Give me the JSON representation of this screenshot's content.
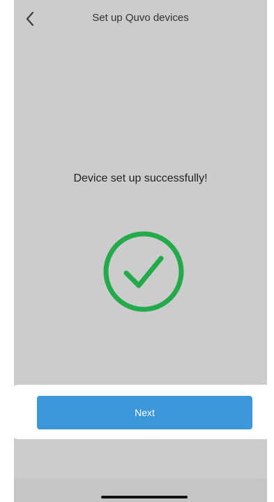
{
  "header": {
    "title": "Set up Quvo devices",
    "back_icon": "chevron-left-icon"
  },
  "main": {
    "message": "Device set up successfully!",
    "status_icon": "check-circle-icon"
  },
  "footer": {
    "next_label": "Next"
  },
  "colors": {
    "screen_background": "#cccccc",
    "success_green": "#22aa4b",
    "button_blue": "#3b97d8"
  }
}
